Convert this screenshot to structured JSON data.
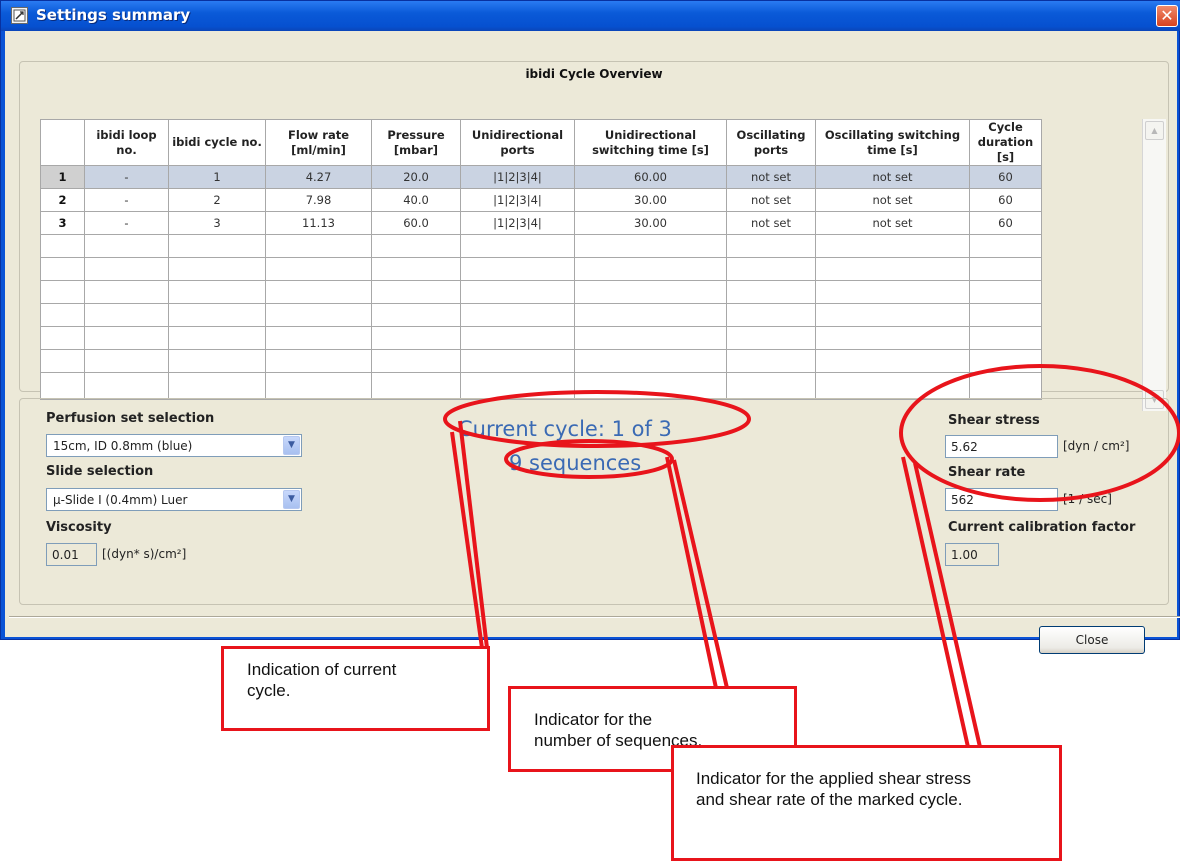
{
  "window": {
    "title": "Settings summary",
    "close_glyph": "✕"
  },
  "overview": {
    "title": "ibidi Cycle Overview",
    "columns": [
      "",
      "ibidi loop no.",
      "ibidi cycle no.",
      "Flow rate [ml/min]",
      "Pressure [mbar]",
      "Unidirectional ports",
      "Unidirectional switching time [s]",
      "Oscillating ports",
      "Oscillating switching time [s]",
      "Cycle duration [s]"
    ],
    "rows": [
      [
        "1",
        "-",
        "1",
        "4.27",
        "20.0",
        "|1|2|3|4|",
        "60.00",
        "not set",
        "not set",
        "60"
      ],
      [
        "2",
        "-",
        "2",
        "7.98",
        "40.0",
        "|1|2|3|4|",
        "30.00",
        "not set",
        "not set",
        "60"
      ],
      [
        "3",
        "-",
        "3",
        "11.13",
        "60.0",
        "|1|2|3|4|",
        "30.00",
        "not set",
        "not set",
        "60"
      ]
    ],
    "selected_row": 0
  },
  "perfusion": {
    "label": "Perfusion set selection",
    "value": "15cm, ID 0.8mm (blue)"
  },
  "slide": {
    "label": "Slide selection",
    "value": "μ-Slide I (0.4mm) Luer"
  },
  "viscosity": {
    "label": "Viscosity",
    "value": "0.01",
    "unit": "[(dyn* s)/cm²]"
  },
  "status": {
    "current_cycle": "Current cycle: 1 of 3",
    "sequences": "9 sequences"
  },
  "shear_stress": {
    "label": "Shear stress",
    "value": "5.62",
    "unit": "[dyn / cm²]"
  },
  "shear_rate": {
    "label": "Shear rate",
    "value": "562",
    "unit": "[1 / sec]"
  },
  "calibration": {
    "label": "Current calibration factor",
    "value": "1.00"
  },
  "buttons": {
    "close": "Close"
  },
  "annotations": {
    "current_cycle": [
      "Indication of current",
      "cycle."
    ],
    "sequences": [
      "Indicator for the",
      "number of sequences."
    ],
    "shear": [
      "Indicator for the applied shear stress",
      "and shear rate of the marked cycle."
    ]
  },
  "colors": {
    "highlight": "#e8141b",
    "title_bar": "#0a5ad8",
    "selected_row": "#cad3e2",
    "status_text": "#3a6ab4"
  },
  "icons": {
    "window_icon": "settings-window-icon",
    "dropdown": "chevron-down-icon"
  }
}
